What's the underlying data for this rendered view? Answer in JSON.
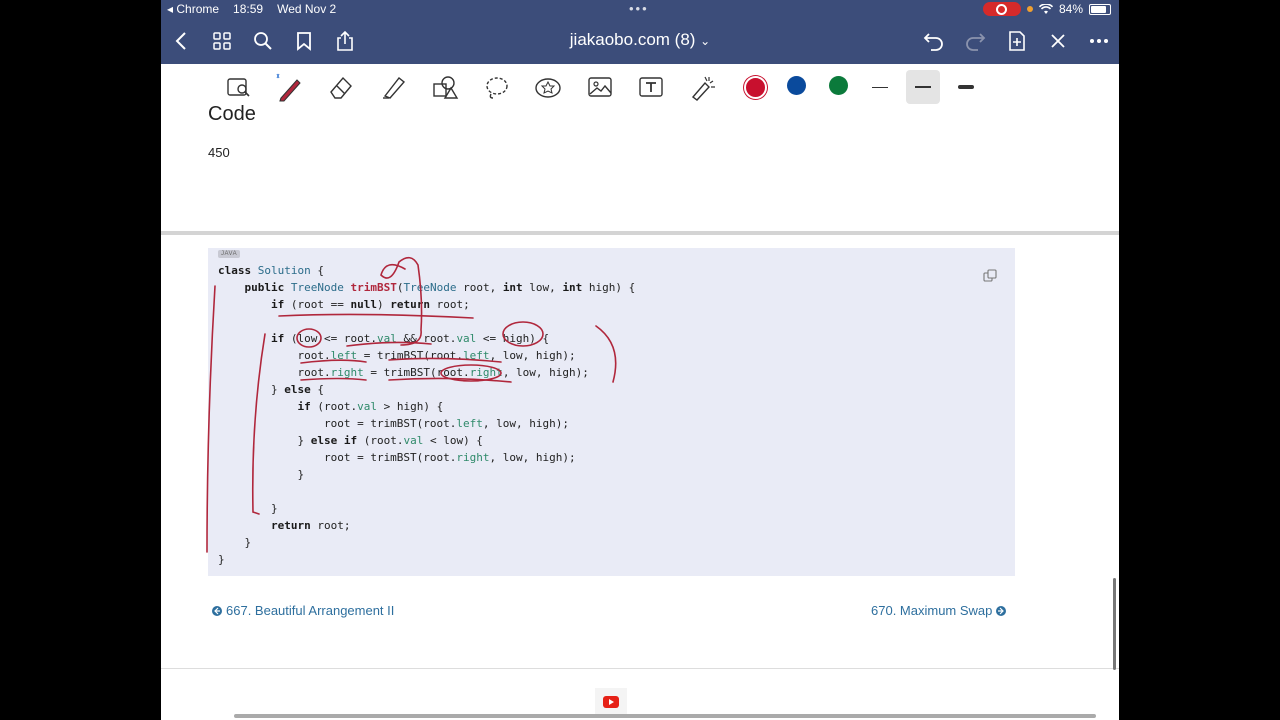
{
  "status_bar": {
    "back_app": "Chrome",
    "time": "18:59",
    "date": "Wed Nov 2",
    "dots": "•••",
    "battery": "84%"
  },
  "nav": {
    "title": "jiakaobo.com (8)",
    "title_chevron": "⌄"
  },
  "toolbar": {
    "colors": [
      "#c8102e",
      "#0a4a9c",
      "#0b7a3b"
    ],
    "selected_color": "#c8102e"
  },
  "content": {
    "heading": "Code",
    "count": "450",
    "lang_badge": "JAVA",
    "code_lines": [
      "class Solution {",
      "    public TreeNode trimBST(TreeNode root, int low, int high) {",
      "        if (root == null) return root;",
      "",
      "        if (low <= root.val && root.val <= high) {",
      "            root.left = trimBST(root.left, low, high);",
      "            root.right = trimBST(root.right, low, high);",
      "        } else {",
      "            if (root.val > high) {",
      "                root = trimBST(root.left, low, high);",
      "            } else if (root.val < low) {",
      "                root = trimBST(root.right, low, high);",
      "            }",
      "",
      "        }",
      "        return root;",
      "    }",
      "}"
    ],
    "prev_link": "667. Beautiful Arrangement II",
    "next_link": "670. Maximum Swap"
  }
}
